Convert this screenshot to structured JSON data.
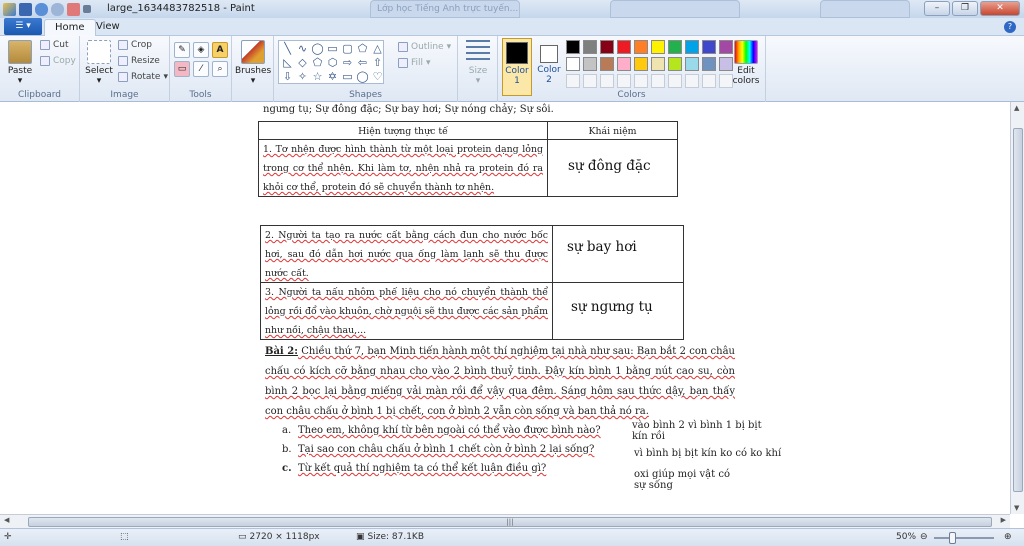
{
  "window": {
    "title": "large_1634483782518 - Paint",
    "bg_tab_text": "Lớp học Tiếng Anh trực tuyến..."
  },
  "ribbon": {
    "tabs": [
      "Home",
      "View"
    ],
    "groups": {
      "clipboard": {
        "label": "Clipboard",
        "paste": "Paste",
        "cut": "Cut",
        "copy": "Copy"
      },
      "image": {
        "label": "Image",
        "select": "Select",
        "crop": "Crop",
        "resize": "Resize",
        "rotate": "Rotate"
      },
      "tools": {
        "label": "Tools"
      },
      "brushes": {
        "label": "Brushes"
      },
      "shapes": {
        "label": "Shapes",
        "outline": "Outline",
        "fill": "Fill"
      },
      "size": {
        "label": "Size"
      },
      "colors": {
        "label": "Colors",
        "color1": "Color 1",
        "color2": "Color 2",
        "edit": "Edit colors",
        "palette": [
          "#000000",
          "#7f7f7f",
          "#880015",
          "#ed1c24",
          "#ff7f27",
          "#fff200",
          "#22b14c",
          "#00a2e8",
          "#3f48cc",
          "#a349a4",
          "#ffffff",
          "#c3c3c3",
          "#b97a57",
          "#ffaec9",
          "#ffc90e",
          "#efe4b0",
          "#b5e61d",
          "#99d9ea",
          "#7092be",
          "#c8bfe7"
        ]
      }
    }
  },
  "document": {
    "top_line": "ngưng tụ; Sự đông đặc; Sự bay hơi; Sự nóng chảy; Sự sôi.",
    "table1": {
      "header_phenomenon": "Hiện tượng thực tế",
      "header_concept": "Khái niệm",
      "row1_text": "1. Tơ nhện được hình thành từ một loại protein dạng lỏng trong cơ thể nhện. Khi làm tơ, nhện nhả ra protein đó ra khỏi cơ thể, protein đó sẽ chuyển thành tơ nhện.",
      "row1_answer": "sự đông đặc"
    },
    "table2": {
      "row2_text": "2. Người ta tạo ra nước cất bằng cách đun cho nước bốc hơi, sau đó dẫn hơi nước qua ống làm lạnh sẽ thu được nước cất.",
      "row2_answer": "sự bay hơi",
      "row3_text": "3. Người ta nấu nhôm phế liệu cho nó chuyển thành thể lỏng rồi đổ vào khuôn, chờ nguội sẽ thu được các sản phẩm như nồi, chậu thau,...",
      "row3_answer": "sự ngưng tụ"
    },
    "bai2": {
      "heading": "Bài 2:",
      "text": " Chiều thứ 7, bạn Minh tiến hành một thí nghiệm tại nhà như sau: Bạn bắt 2 con châu chấu có kích cỡ bằng nhau cho vào 2 bình thuỷ tinh. Đậy kín bình 1 bằng nút cao su, còn bình 2 bọc lại bằng miếng vải màn rồi để vậy qua đêm. Sáng hôm sau thức dậy, bạn thấy con châu chấu ở bình 1 bị chết, con ở bình 2 vẫn còn sống và ban thả nó ra.",
      "questions": [
        {
          "label": "a.",
          "text": "Theo em, không khí từ bên ngoài có thể vào được bình nào?"
        },
        {
          "label": "b.",
          "text": "Tại sao con châu chấu ở bình 1 chết còn ở bình 2 lại sống?"
        },
        {
          "label": "c.",
          "text": "Từ kết quả thí nghiệm ta có thể kết luận điều gì?"
        }
      ],
      "answers": [
        "vào bình 2 vì bình 1 bị bịt kín rồi",
        "vì bình bị bịt kín ko có ko khí",
        "oxi giúp mọi vật có sự sống"
      ]
    }
  },
  "status": {
    "dimensions": "2720 × 1118px",
    "size": "Size: 87.1KB",
    "zoom": "50%"
  }
}
